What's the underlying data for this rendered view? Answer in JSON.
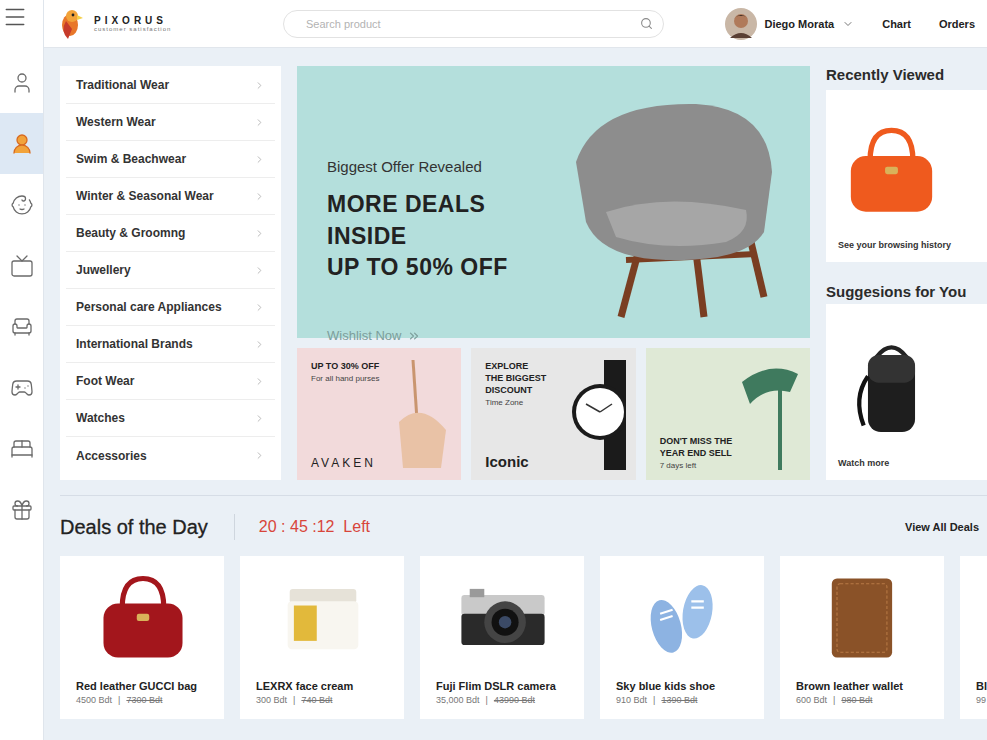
{
  "header": {
    "logo": {
      "name": "PIXORUS",
      "tagline": "customer satisfaction"
    },
    "search": {
      "placeholder": "Search product"
    },
    "user": {
      "name": "Diego Morata"
    },
    "links": [
      "Chart",
      "Orders"
    ]
  },
  "rail": [
    {
      "selected": false
    },
    {
      "selected": true
    },
    {
      "selected": false
    },
    {
      "selected": false
    },
    {
      "selected": false
    },
    {
      "selected": false
    },
    {
      "selected": false
    },
    {
      "selected": false
    }
  ],
  "categories": [
    "Traditional Wear",
    "Western Wear",
    "Swim & Beachwear",
    "Winter & Seasonal Wear",
    "Beauty & Groomng",
    "Juwellery",
    "Personal care Appliances",
    "International Brands",
    "Foot Wear",
    "Watches",
    "Accessories"
  ],
  "hero": {
    "eyebrow": "Biggest Offer Revealed",
    "headline": [
      "MORE DEALS INSIDE",
      "UP TO 50% OFF"
    ],
    "cta": "Wishlist Now"
  },
  "promos": [
    {
      "kind": "purse",
      "title": [
        "UP TO 30% OFF"
      ],
      "subtitle": "For all hand purses",
      "brand": "AVAKEN",
      "color": "#f2dadb"
    },
    {
      "kind": "watch",
      "title": [
        "EXPLORE",
        "THE BIGGEST",
        "DISCOUNT"
      ],
      "subtitle": "Time Zone",
      "brand": "Iconic",
      "color": "#e7e7e7"
    },
    {
      "kind": "lamp",
      "title": [
        "DON'T MISS THE",
        "YEAR END SELL"
      ],
      "subtitle": "7 days left",
      "color": "#dfe9d6"
    }
  ],
  "recently_viewed": {
    "title": "Recently Viewed",
    "caption": "See your browsing history"
  },
  "suggestions": {
    "title": "Suggesions for You",
    "caption": "Watch more"
  },
  "deals": {
    "title": "Deals of the Day",
    "timer": "20 : 45 :12  Left",
    "view_all": "View All Deals",
    "price_separator": "|",
    "items": [
      {
        "kind": "handbag",
        "name": "Red leather GUCCI bag",
        "price": "4500 Bdt",
        "old_price": "7300 Bdt"
      },
      {
        "kind": "cream",
        "name": "LEXRX face cream",
        "price": "300 Bdt",
        "old_price": "740 Bdt"
      },
      {
        "kind": "camera",
        "name": "Fuji Flim DSLR camera",
        "price": "35,000 Bdt",
        "old_price": "43990 Bdt"
      },
      {
        "kind": "shoes",
        "name": "Sky blue kids shoe",
        "price": "910 Bdt",
        "old_price": "1390 Bdt"
      },
      {
        "kind": "wallet",
        "name": "Brown leather wallet",
        "price": "600 Bdt",
        "old_price": "980 Bdt"
      },
      {
        "kind": "unknown",
        "name": "Bl",
        "price": "99"
      }
    ]
  }
}
